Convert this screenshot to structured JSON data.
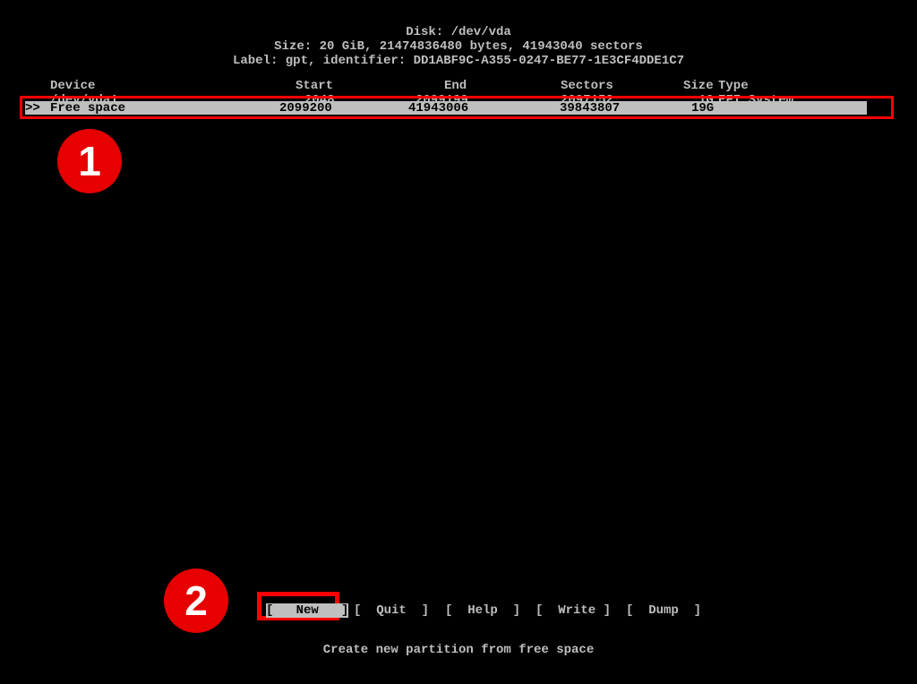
{
  "header": {
    "disk_line": "Disk: /dev/vda",
    "size_line": "Size: 20 GiB, 21474836480 bytes, 41943040 sectors",
    "label_line": "Label: gpt, identifier: DD1ABF9C-A355-0247-BE77-1E3CF4DDE1C7"
  },
  "columns": {
    "device": "Device",
    "start": "Start",
    "end": "End",
    "sectors": "Sectors",
    "size": "Size",
    "type": "Type"
  },
  "rows": [
    {
      "device": "/dev/vda1",
      "start": "2048",
      "end": "2099199",
      "sectors": "2097152",
      "size": "1G",
      "type": "EFI System",
      "selected": false
    },
    {
      "device": "Free space",
      "start": "2099200",
      "end": "41943006",
      "sectors": "39843807",
      "size": "19G",
      "type": "",
      "selected": true,
      "marker": ">>"
    }
  ],
  "menu": {
    "new": "[   New   ]",
    "quit": "[  Quit  ]",
    "help": "[  Help  ]",
    "write": "[  Write ]",
    "dump": "[  Dump  ]"
  },
  "hint": "Create new partition from free space",
  "annotations": {
    "badge1": "1",
    "badge2": "2"
  }
}
